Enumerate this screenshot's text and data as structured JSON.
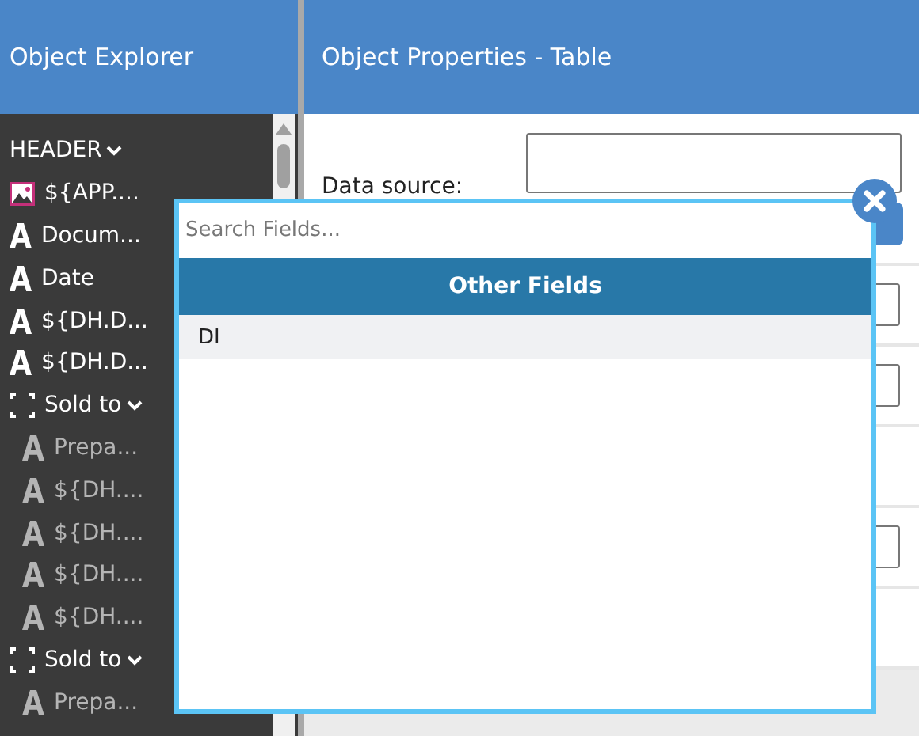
{
  "explorer": {
    "title": "Object Explorer",
    "tree": [
      {
        "label": "HEADER",
        "kind": "section",
        "expanded": true,
        "children": [
          {
            "label": "${APP....",
            "kind": "image"
          },
          {
            "label": "Docum...",
            "kind": "text"
          },
          {
            "label": "Date",
            "kind": "text"
          },
          {
            "label": "${DH.D...",
            "kind": "text"
          },
          {
            "label": "${DH.D...",
            "kind": "text"
          },
          {
            "label": "Sold to",
            "kind": "group",
            "expanded": true,
            "children": [
              {
                "label": "Prepa...",
                "kind": "text"
              },
              {
                "label": "${DH....",
                "kind": "text"
              },
              {
                "label": "${DH....",
                "kind": "text"
              },
              {
                "label": "${DH....",
                "kind": "text"
              },
              {
                "label": "${DH....",
                "kind": "text"
              }
            ]
          },
          {
            "label": "Sold to",
            "kind": "group",
            "expanded": true,
            "children": [
              {
                "label": "Prepa...",
                "kind": "text"
              }
            ]
          }
        ]
      }
    ]
  },
  "properties": {
    "title": "Object Properties - Table",
    "rows": [
      {
        "kind": "textarea",
        "label": "Data source:"
      },
      {
        "kind": "input"
      },
      {
        "kind": "input"
      },
      {
        "kind": "blank"
      },
      {
        "kind": "input"
      },
      {
        "kind": "blank"
      }
    ]
  },
  "field_picker": {
    "search": {
      "placeholder": "Search Fields..."
    },
    "group_title": "Other Fields",
    "items": [
      {
        "label": "DI"
      }
    ]
  }
}
